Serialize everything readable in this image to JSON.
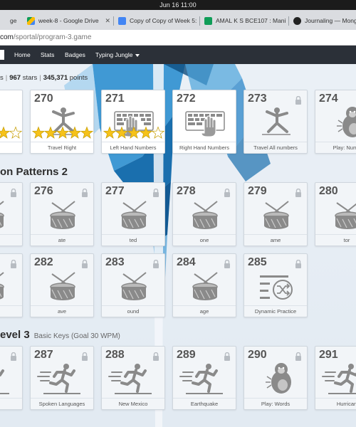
{
  "system": {
    "clock": "Jun 16  11:00"
  },
  "browser": {
    "tabs": [
      {
        "title": "ge",
        "color": "#4a4a4a"
      },
      {
        "title": "week-8 - Google Drive",
        "color": "#1a73e8"
      },
      {
        "title": "Copy of Copy of Week 5:",
        "color": "#4285f4"
      },
      {
        "title": "AMAL K S BCE107 : Mani",
        "color": "#0f9d58"
      },
      {
        "title": "Journaling — Mongo",
        "color": "#222222"
      }
    ],
    "url_host": "com",
    "url_path": "/sportal/program-3.game"
  },
  "nav": {
    "items": [
      "Home",
      "Stats",
      "Badges",
      "Typing Jungle"
    ]
  },
  "stats": {
    "lead": "s",
    "stars": "967",
    "stars_label": "stars",
    "points": "345,371",
    "points_label": "points"
  },
  "sections": {
    "patterns": {
      "title": "on Patterns 2"
    },
    "level3": {
      "title": "evel 3",
      "subtitle": "Basic Keys (Goal 30 WPM)"
    }
  },
  "cards_row1": [
    {
      "num": "",
      "label": "ft",
      "stars": 5,
      "filled": 4,
      "icon": "partial-icon",
      "locked": false
    },
    {
      "num": "270",
      "label": "Travel Right",
      "stars": 5,
      "filled": 5,
      "icon": "yoga-pose-icon",
      "locked": false
    },
    {
      "num": "271",
      "label": "Left Hand Numbers",
      "stars": 5,
      "filled": 4,
      "icon": "keyboard-left-hand-icon",
      "locked": false
    },
    {
      "num": "272",
      "label": "Right Hand Numbers",
      "stars": 0,
      "filled": 0,
      "icon": "keyboard-right-hand-icon",
      "locked": false
    },
    {
      "num": "273",
      "label": "Travel All numbers",
      "stars": 0,
      "filled": 0,
      "icon": "yoga-pose-icon",
      "locked": true
    },
    {
      "num": "274",
      "label": "Play: Numb",
      "stars": 0,
      "filled": 0,
      "icon": "gorilla-icon",
      "locked": true
    }
  ],
  "cards_row2": [
    {
      "num": "",
      "label": "",
      "icon": "drum-icon",
      "locked": true
    },
    {
      "num": "276",
      "label": "ate",
      "icon": "drum-icon",
      "locked": true
    },
    {
      "num": "277",
      "label": "ted",
      "icon": "drum-icon",
      "locked": true
    },
    {
      "num": "278",
      "label": "one",
      "icon": "drum-icon",
      "locked": true
    },
    {
      "num": "279",
      "label": "ame",
      "icon": "drum-icon",
      "locked": true
    },
    {
      "num": "280",
      "label": "tor",
      "icon": "drum-icon",
      "locked": true
    }
  ],
  "cards_row3": [
    {
      "num": "",
      "label": "",
      "icon": "drum-icon",
      "locked": true
    },
    {
      "num": "282",
      "label": "ave",
      "icon": "drum-icon",
      "locked": true
    },
    {
      "num": "283",
      "label": "ound",
      "icon": "drum-icon",
      "locked": true
    },
    {
      "num": "284",
      "label": "age",
      "icon": "drum-icon",
      "locked": true
    },
    {
      "num": "285",
      "label": "Dynamic Practice",
      "icon": "shuffle-list-icon",
      "locked": true
    }
  ],
  "cards_row4": [
    {
      "num": "",
      "label": "sco",
      "icon": "runner-icon",
      "locked": true
    },
    {
      "num": "287",
      "label": "Spoken Languages",
      "icon": "runner-icon",
      "locked": true
    },
    {
      "num": "288",
      "label": "New Mexico",
      "icon": "runner-icon",
      "locked": true
    },
    {
      "num": "289",
      "label": "Earthquake",
      "icon": "runner-icon",
      "locked": true
    },
    {
      "num": "290",
      "label": "Play: Words",
      "icon": "gorilla-icon",
      "locked": true
    },
    {
      "num": "291",
      "label": "Hurrican",
      "icon": "runner-icon",
      "locked": true
    }
  ],
  "colors": {
    "star_gold": "#f6c21a",
    "nav_bg": "#2b3038",
    "art_blue": "#1f7ec0"
  }
}
